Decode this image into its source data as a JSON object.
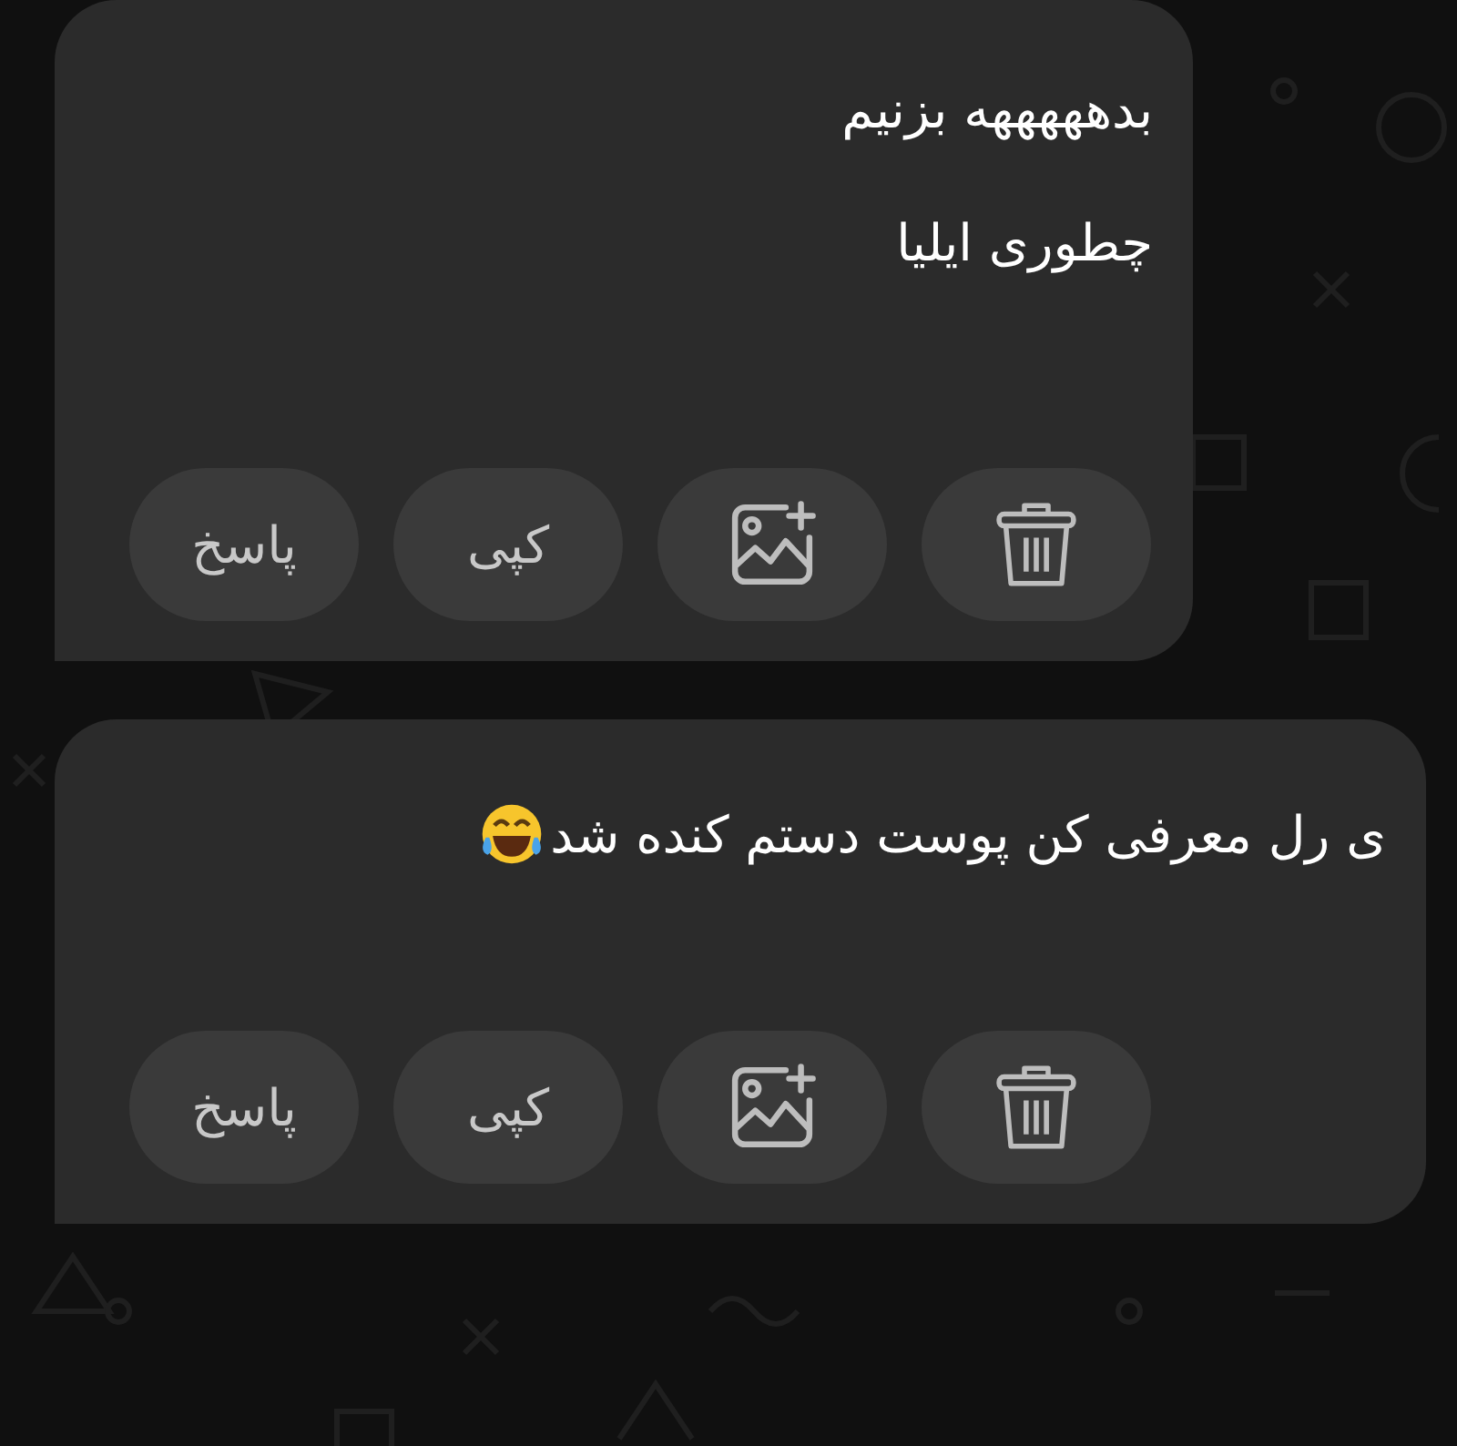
{
  "messages": [
    {
      "lines": [
        "بدهههههه بزنیم",
        "چطوری ایلیا"
      ],
      "emoji": false,
      "actions": [
        {
          "kind": "delete"
        },
        {
          "kind": "image"
        },
        {
          "kind": "copy",
          "label": "کپی"
        },
        {
          "kind": "reply",
          "label": "پاسخ"
        }
      ]
    },
    {
      "lines": [
        "ی رل معرفی کن پوست دستم کنده شد"
      ],
      "emoji": true,
      "actions": [
        {
          "kind": "delete"
        },
        {
          "kind": "image"
        },
        {
          "kind": "copy",
          "label": "کپی"
        },
        {
          "kind": "reply",
          "label": "پاسخ"
        }
      ]
    }
  ]
}
